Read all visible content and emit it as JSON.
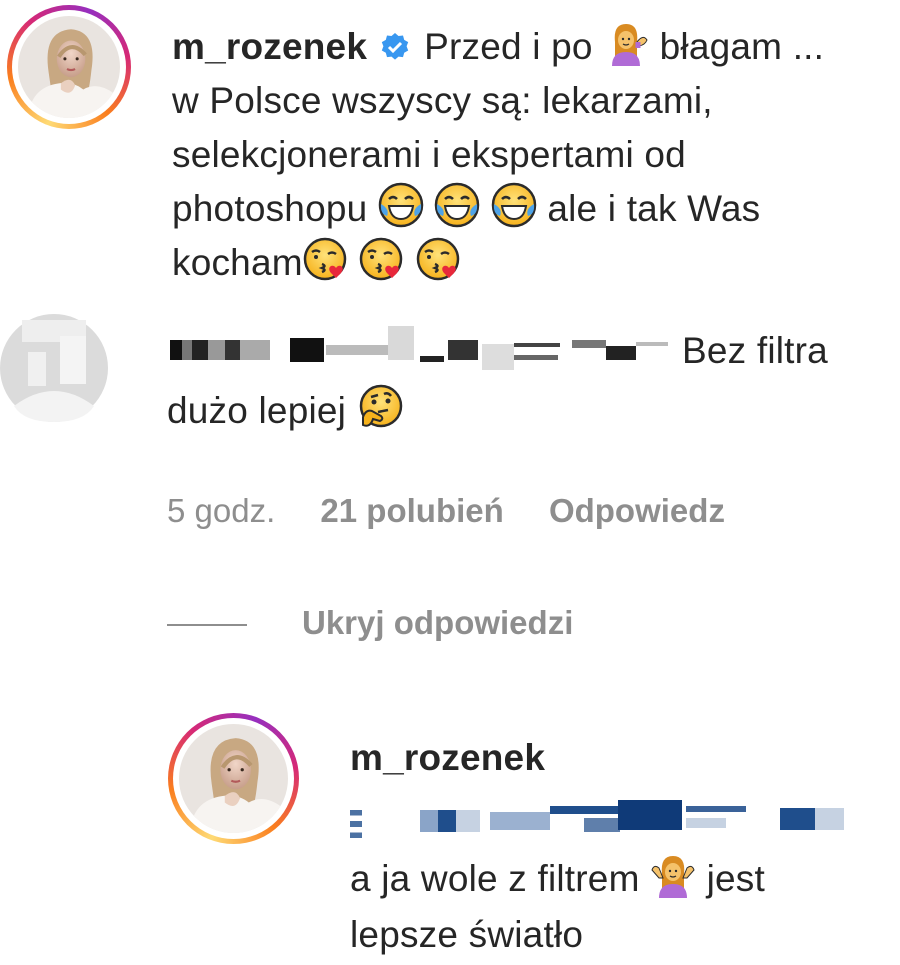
{
  "post": {
    "username": "m_rozenek",
    "verified_icon": "verified-badge-icon",
    "caption_lines": [
      "Przed i po",
      "błagam ...",
      "w Polsce wszyscy są: lekarzami,",
      "selekcjonerami i ekspertami od",
      "photoshopu",
      "ale i tak Was",
      "kocham"
    ]
  },
  "comment": {
    "username_redacted": true,
    "text_part1": "Bez filtra",
    "text_part2": "dużo lepiej",
    "time": "5 godz.",
    "likes": "21 polubień",
    "reply_label": "Odpowiedz"
  },
  "replies_toggle": {
    "label": "Ukryj odpowiedzi"
  },
  "reply": {
    "username": "m_rozenek",
    "mention_redacted": true,
    "text_part1": "a ja wole z filtrem",
    "text_part2": "jest",
    "text_part3": "lepsze światło"
  },
  "icons": {
    "tipping_hand": "woman-tipping-hand-icon",
    "laugh": "face-with-tears-of-joy-icon",
    "kiss": "face-blowing-kiss-icon",
    "thinking": "thinking-face-icon",
    "shrug": "woman-shrugging-icon"
  },
  "colors": {
    "text": "#262626",
    "secondary": "#8e8e8e",
    "verified": "#3897f0",
    "redaction": "#1f4e8c"
  }
}
